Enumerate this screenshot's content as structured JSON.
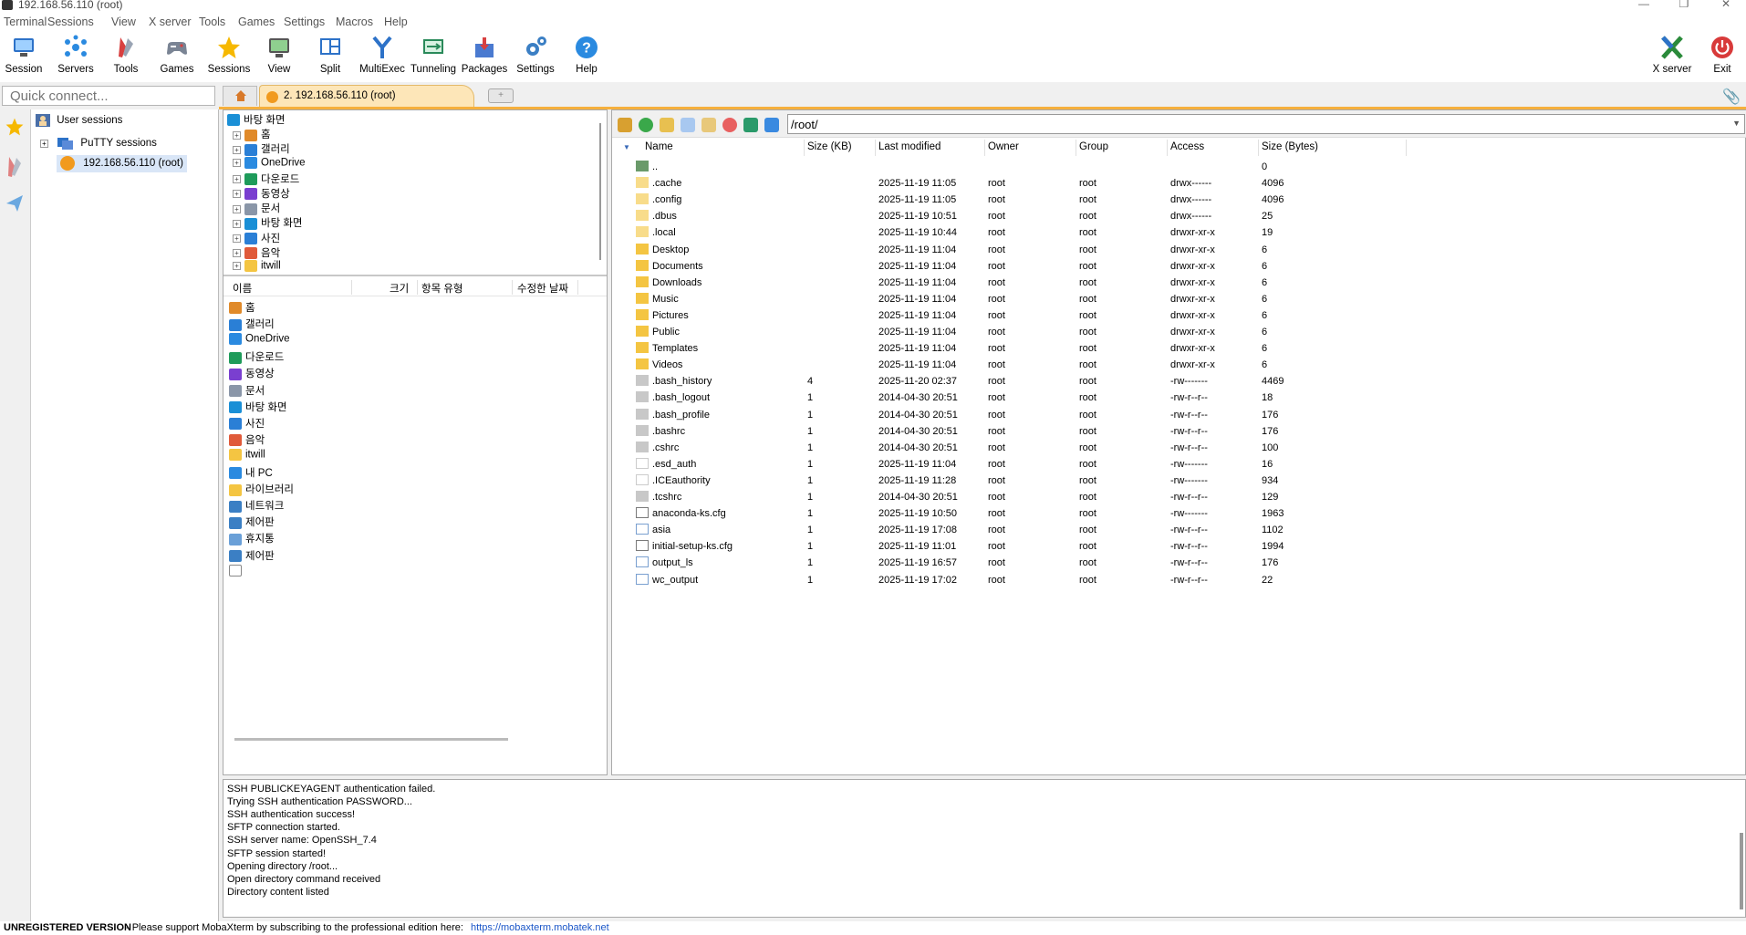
{
  "window": {
    "title": "192.168.56.110 (root)"
  },
  "menu": [
    "Terminal",
    "Sessions",
    "View",
    "X server",
    "Tools",
    "Games",
    "Settings",
    "Macros",
    "Help"
  ],
  "toolbar": {
    "session": "Session",
    "servers": "Servers",
    "tools": "Tools",
    "games": "Games",
    "sessions": "Sessions",
    "view": "View",
    "split": "Split",
    "multiexec": "MultiExec",
    "tunneling": "Tunneling",
    "packages": "Packages",
    "settings": "Settings",
    "help": "Help",
    "xserver": "X server",
    "exit": "Exit"
  },
  "quickconnect": {
    "placeholder": "Quick connect..."
  },
  "tabs": {
    "session_tab": "2. 192.168.56.110 (root)"
  },
  "sidebar": {
    "user_sessions": "User sessions",
    "putty_sessions": "PuTTY sessions",
    "session_item": "192.168.56.110 (root)"
  },
  "local_tree": [
    {
      "label": "바탕 화면",
      "icon": "desktop-icon",
      "color": "#1a8fd6"
    },
    {
      "label": "홈",
      "icon": "home-icon",
      "color": "#e08a2a"
    },
    {
      "label": "갤러리",
      "icon": "gallery-icon",
      "color": "#2a7fd6"
    },
    {
      "label": "OneDrive",
      "icon": "cloud-icon",
      "color": "#2a8ae0"
    },
    {
      "label": "다운로드",
      "icon": "download-icon",
      "color": "#1e9b5a"
    },
    {
      "label": "동영상",
      "icon": "video-icon",
      "color": "#7a3fd0"
    },
    {
      "label": "문서",
      "icon": "document-icon",
      "color": "#8a96a8"
    },
    {
      "label": "바탕 화면",
      "icon": "desktop-icon",
      "color": "#1a8fd6"
    },
    {
      "label": "사진",
      "icon": "picture-icon",
      "color": "#2a7fd6"
    },
    {
      "label": "음악",
      "icon": "music-icon",
      "color": "#e05a3a"
    },
    {
      "label": "itwill",
      "icon": "folder-icon",
      "color": "#f4c542"
    },
    {
      "label": "내 PC",
      "icon": "pc-icon",
      "color": "#2a8ae0"
    }
  ],
  "local_list_header": {
    "name": "이름",
    "size": "크기",
    "type": "항목 유형",
    "modified": "수정한 날짜"
  },
  "local_list": [
    {
      "label": "홈",
      "icon": "home-icon",
      "color": "#e08a2a"
    },
    {
      "label": "갤러리",
      "icon": "gallery-icon",
      "color": "#2a7fd6"
    },
    {
      "label": "OneDrive",
      "icon": "cloud-icon",
      "color": "#2a8ae0"
    },
    {
      "label": "다운로드",
      "icon": "download-icon",
      "color": "#1e9b5a"
    },
    {
      "label": "동영상",
      "icon": "video-icon",
      "color": "#7a3fd0"
    },
    {
      "label": "문서",
      "icon": "document-icon",
      "color": "#8a96a8"
    },
    {
      "label": "바탕 화면",
      "icon": "desktop-icon",
      "color": "#1a8fd6"
    },
    {
      "label": "사진",
      "icon": "picture-icon",
      "color": "#2a7fd6"
    },
    {
      "label": "음악",
      "icon": "music-icon",
      "color": "#e05a3a"
    },
    {
      "label": "itwill",
      "icon": "folder-icon",
      "color": "#f4c542"
    },
    {
      "label": "내 PC",
      "icon": "pc-icon",
      "color": "#2a8ae0"
    },
    {
      "label": "라이브러리",
      "icon": "library-icon",
      "color": "#f4c542"
    },
    {
      "label": "네트워크",
      "icon": "network-icon",
      "color": "#3b7fc4"
    },
    {
      "label": "제어판",
      "icon": "control-panel-icon",
      "color": "#3b7fc4"
    },
    {
      "label": "휴지통",
      "icon": "recycle-bin-icon",
      "color": "#6aa0d8"
    },
    {
      "label": "제어판",
      "icon": "control-panel-icon",
      "color": "#3b7fc4"
    },
    {
      "label": "",
      "icon": "blank-file-icon",
      "color": "#ffffff"
    }
  ],
  "sftp": {
    "path": "/root/",
    "headers": {
      "name": "Name",
      "size_kb": "Size (KB)",
      "modified": "Last modified",
      "owner": "Owner",
      "group": "Group",
      "access": "Access",
      "size_bytes": "Size (Bytes)"
    },
    "files": [
      {
        "name": "..",
        "size_kb": "",
        "modified": "",
        "owner": "",
        "group": "",
        "access": "",
        "bytes": "0",
        "kind": "up"
      },
      {
        "name": ".cache",
        "size_kb": "",
        "modified": "2025-11-19 11:05",
        "owner": "root",
        "group": "root",
        "access": "drwx------",
        "bytes": "4096",
        "kind": "hidden-folder"
      },
      {
        "name": ".config",
        "size_kb": "",
        "modified": "2025-11-19 11:05",
        "owner": "root",
        "group": "root",
        "access": "drwx------",
        "bytes": "4096",
        "kind": "hidden-folder"
      },
      {
        "name": ".dbus",
        "size_kb": "",
        "modified": "2025-11-19 10:51",
        "owner": "root",
        "group": "root",
        "access": "drwx------",
        "bytes": "25",
        "kind": "hidden-folder"
      },
      {
        "name": ".local",
        "size_kb": "",
        "modified": "2025-11-19 10:44",
        "owner": "root",
        "group": "root",
        "access": "drwxr-xr-x",
        "bytes": "19",
        "kind": "hidden-folder"
      },
      {
        "name": "Desktop",
        "size_kb": "",
        "modified": "2025-11-19 11:04",
        "owner": "root",
        "group": "root",
        "access": "drwxr-xr-x",
        "bytes": "6",
        "kind": "folder"
      },
      {
        "name": "Documents",
        "size_kb": "",
        "modified": "2025-11-19 11:04",
        "owner": "root",
        "group": "root",
        "access": "drwxr-xr-x",
        "bytes": "6",
        "kind": "folder"
      },
      {
        "name": "Downloads",
        "size_kb": "",
        "modified": "2025-11-19 11:04",
        "owner": "root",
        "group": "root",
        "access": "drwxr-xr-x",
        "bytes": "6",
        "kind": "folder"
      },
      {
        "name": "Music",
        "size_kb": "",
        "modified": "2025-11-19 11:04",
        "owner": "root",
        "group": "root",
        "access": "drwxr-xr-x",
        "bytes": "6",
        "kind": "folder"
      },
      {
        "name": "Pictures",
        "size_kb": "",
        "modified": "2025-11-19 11:04",
        "owner": "root",
        "group": "root",
        "access": "drwxr-xr-x",
        "bytes": "6",
        "kind": "folder"
      },
      {
        "name": "Public",
        "size_kb": "",
        "modified": "2025-11-19 11:04",
        "owner": "root",
        "group": "root",
        "access": "drwxr-xr-x",
        "bytes": "6",
        "kind": "folder"
      },
      {
        "name": "Templates",
        "size_kb": "",
        "modified": "2025-11-19 11:04",
        "owner": "root",
        "group": "root",
        "access": "drwxr-xr-x",
        "bytes": "6",
        "kind": "folder"
      },
      {
        "name": "Videos",
        "size_kb": "",
        "modified": "2025-11-19 11:04",
        "owner": "root",
        "group": "root",
        "access": "drwxr-xr-x",
        "bytes": "6",
        "kind": "folder"
      },
      {
        "name": ".bash_history",
        "size_kb": "4",
        "modified": "2025-11-20 02:37",
        "owner": "root",
        "group": "root",
        "access": "-rw-------",
        "bytes": "4469",
        "kind": "hidden-file"
      },
      {
        "name": ".bash_logout",
        "size_kb": "1",
        "modified": "2014-04-30 20:51",
        "owner": "root",
        "group": "root",
        "access": "-rw-r--r--",
        "bytes": "18",
        "kind": "hidden-file"
      },
      {
        "name": ".bash_profile",
        "size_kb": "1",
        "modified": "2014-04-30 20:51",
        "owner": "root",
        "group": "root",
        "access": "-rw-r--r--",
        "bytes": "176",
        "kind": "hidden-file"
      },
      {
        "name": ".bashrc",
        "size_kb": "1",
        "modified": "2014-04-30 20:51",
        "owner": "root",
        "group": "root",
        "access": "-rw-r--r--",
        "bytes": "176",
        "kind": "hidden-file"
      },
      {
        "name": ".cshrc",
        "size_kb": "1",
        "modified": "2014-04-30 20:51",
        "owner": "root",
        "group": "root",
        "access": "-rw-r--r--",
        "bytes": "100",
        "kind": "hidden-file"
      },
      {
        "name": ".esd_auth",
        "size_kb": "1",
        "modified": "2025-11-19 11:04",
        "owner": "root",
        "group": "root",
        "access": "-rw-------",
        "bytes": "16",
        "kind": "blank-file"
      },
      {
        "name": ".ICEauthority",
        "size_kb": "1",
        "modified": "2025-11-19 11:28",
        "owner": "root",
        "group": "root",
        "access": "-rw-------",
        "bytes": "934",
        "kind": "blank-file"
      },
      {
        "name": ".tcshrc",
        "size_kb": "1",
        "modified": "2014-04-30 20:51",
        "owner": "root",
        "group": "root",
        "access": "-rw-r--r--",
        "bytes": "129",
        "kind": "hidden-file"
      },
      {
        "name": "anaconda-ks.cfg",
        "size_kb": "1",
        "modified": "2025-11-19 10:50",
        "owner": "root",
        "group": "root",
        "access": "-rw-------",
        "bytes": "1963",
        "kind": "cfg-file"
      },
      {
        "name": "asia",
        "size_kb": "1",
        "modified": "2025-11-19 17:08",
        "owner": "root",
        "group": "root",
        "access": "-rw-r--r--",
        "bytes": "1102",
        "kind": "file"
      },
      {
        "name": "initial-setup-ks.cfg",
        "size_kb": "1",
        "modified": "2025-11-19 11:01",
        "owner": "root",
        "group": "root",
        "access": "-rw-r--r--",
        "bytes": "1994",
        "kind": "cfg-file"
      },
      {
        "name": "output_ls",
        "size_kb": "1",
        "modified": "2025-11-19 16:57",
        "owner": "root",
        "group": "root",
        "access": "-rw-r--r--",
        "bytes": "176",
        "kind": "file"
      },
      {
        "name": "wc_output",
        "size_kb": "1",
        "modified": "2025-11-19 17:02",
        "owner": "root",
        "group": "root",
        "access": "-rw-r--r--",
        "bytes": "22",
        "kind": "file"
      }
    ]
  },
  "log": [
    "SSH PUBLICKEYAGENT authentication failed.",
    "Trying SSH authentication PASSWORD...",
    "SSH authentication success!",
    "SFTP connection started.",
    "SSH server name: OpenSSH_7.4",
    "SFTP session started!",
    "Opening directory /root...",
    "Open directory command received",
    "Directory content listed"
  ],
  "status": {
    "unregistered": "UNREGISTERED VERSION",
    "message": " -  Please support MobaXterm by subscribing to the professional edition here:",
    "link": "https://mobaxterm.mobatek.net"
  },
  "colors": {
    "accent_orange": "#f6b03d",
    "tab_bg": "#fde6b8",
    "folder_yellow": "#f4c542",
    "link_blue": "#1a56c8"
  }
}
